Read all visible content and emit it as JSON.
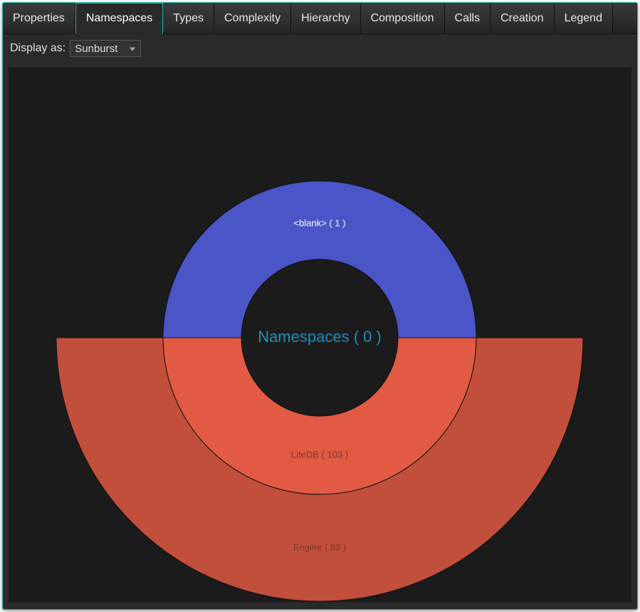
{
  "tabs": {
    "items": [
      {
        "label": "Properties"
      },
      {
        "label": "Namespaces"
      },
      {
        "label": "Types"
      },
      {
        "label": "Complexity"
      },
      {
        "label": "Hierarchy"
      },
      {
        "label": "Composition"
      },
      {
        "label": "Calls"
      },
      {
        "label": "Creation"
      },
      {
        "label": "Legend"
      }
    ],
    "activeIndex": 1
  },
  "toolbar": {
    "display_as_label": "Display as:",
    "display_as_value": "Sunburst"
  },
  "chart_data": {
    "type": "pie",
    "title": "Namespaces ( 0 )",
    "rings": [
      {
        "level": 1,
        "slices": [
          {
            "label": "<blank> ( 1 )",
            "value": 1,
            "start_angle": -180,
            "end_angle": 0,
            "color": "#4a55c8"
          },
          {
            "label": "LiteDB ( 103 )",
            "value": 103,
            "start_angle": 0,
            "end_angle": 180,
            "color": "#e25a44"
          }
        ]
      },
      {
        "level": 2,
        "slices": [
          {
            "label": "Engine ( 83 )",
            "value": 83,
            "start_angle": 0,
            "end_angle": 180,
            "color": "#c24f3b"
          }
        ]
      }
    ]
  }
}
